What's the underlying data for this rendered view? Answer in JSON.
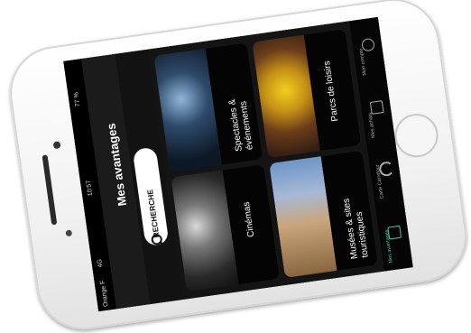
{
  "status_bar": {
    "carrier": "Orange F",
    "network": "4G",
    "time": "10:57",
    "battery": "77 %"
  },
  "header": {
    "title": "Mes avantages"
  },
  "search": {
    "label": "RECHERCHE",
    "icon": "search-icon"
  },
  "categories": [
    {
      "label": "Cinémas"
    },
    {
      "label": "Musées & sites touristiques"
    },
    {
      "label": "Spectacles & événements"
    },
    {
      "label": "Parcs de loisirs"
    }
  ],
  "tabs": [
    {
      "label": "Mes avantages",
      "icon": "gift-icon",
      "active": true
    },
    {
      "label": "Carte Carrefour",
      "icon": "reload-icon",
      "active": false
    },
    {
      "label": "Mes achats",
      "icon": "card-icon",
      "active": false
    },
    {
      "label": "Mon compte",
      "icon": "user-icon",
      "active": false
    }
  ],
  "colors": {
    "accent": "#4fc3a8",
    "background": "#111111"
  }
}
